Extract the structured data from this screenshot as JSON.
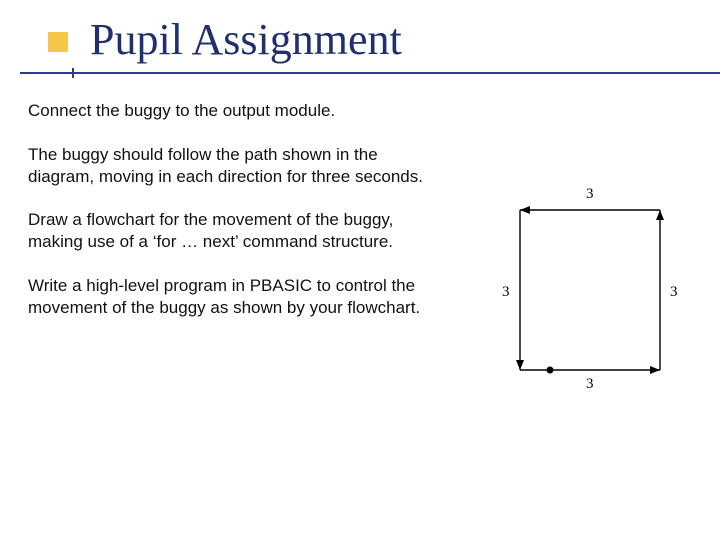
{
  "title": "Pupil Assignment",
  "paragraphs": {
    "p1": "Connect the buggy to the output module.",
    "p2": "The buggy should follow the path shown in the diagram, moving in each direction for three seconds.",
    "p3": "Draw a flowchart for the movement of the buggy, making use of a ‘for … next’ command structure.",
    "p4": "Write a high-level program in PBASIC to control the movement of the buggy as shown by your flowchart."
  },
  "diagram": {
    "labels": {
      "top": "3",
      "left": "3",
      "right": "3",
      "bottom": "3"
    }
  }
}
